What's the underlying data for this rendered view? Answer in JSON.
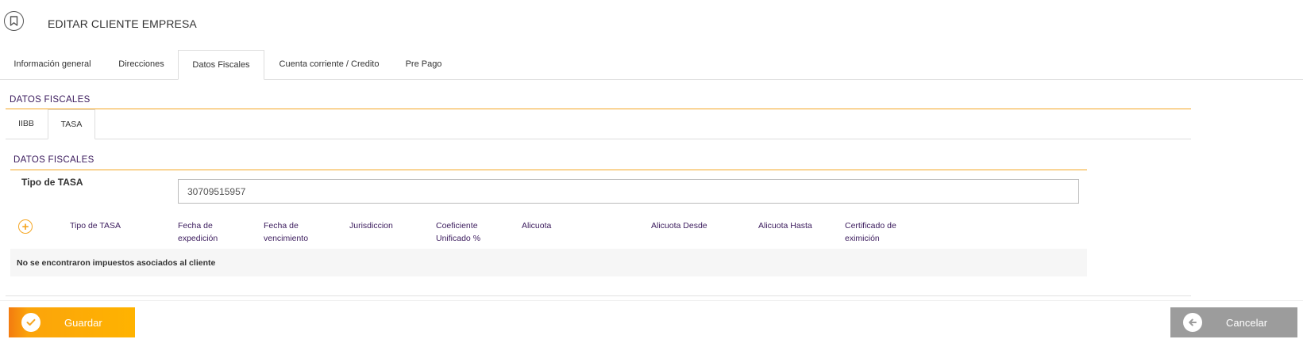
{
  "header": {
    "title": "EDITAR CLIENTE EMPRESA",
    "icon": "bookmark-icon"
  },
  "tabs": [
    "Información general",
    "Direcciones",
    "Datos Fiscales",
    "Cuenta corriente / Credito",
    "Pre Pago"
  ],
  "active_tab": "Datos Fiscales",
  "fiscal": {
    "section_title": "DATOS FISCALES",
    "subtabs": [
      "IIBB",
      "TASA"
    ],
    "active_subtab": "TASA",
    "inner_title": "DATOS FISCALES",
    "tipo_label": "Tipo de TASA",
    "tipo_value": "30709515957",
    "columns": [
      "Tipo de TASA",
      "Fecha de expedición",
      "Fecha de vencimiento",
      "Jurisdiccion",
      "Coeficiente Unificado %",
      "Alicuota",
      "Alicuota Desde",
      "Alicuota Hasta",
      "Certificado de eximición"
    ],
    "empty_message": "No se encontraron impuestos asociados al cliente"
  },
  "actions": {
    "save_label": "Guardar",
    "cancel_label": "Cancelar"
  },
  "colors": {
    "accent": "#f5a623",
    "heading": "#3a1a5c",
    "save_bg": "#ffb300",
    "cancel_bg": "#9c9c9c"
  }
}
